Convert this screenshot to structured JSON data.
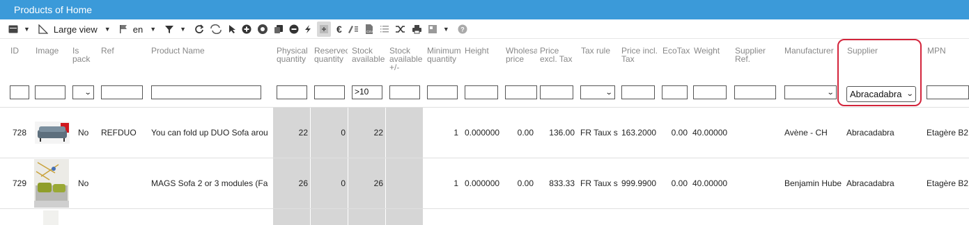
{
  "title": "Products of Home",
  "toolbar": {
    "view_label": "Large view",
    "lang_label": "en"
  },
  "columns": [
    {
      "key": "id",
      "label": "ID"
    },
    {
      "key": "image",
      "label": "Image"
    },
    {
      "key": "is_pack",
      "label": "Is pack"
    },
    {
      "key": "ref",
      "label": "Ref"
    },
    {
      "key": "name",
      "label": "Product Name"
    },
    {
      "key": "physical_qty",
      "label": "Physical quantity"
    },
    {
      "key": "reserved_qty",
      "label": "Reservec quantity"
    },
    {
      "key": "stock_available",
      "label": "Stock available"
    },
    {
      "key": "stock_available_pm",
      "label": "Stock available +/-"
    },
    {
      "key": "min_qty",
      "label": "Minimum quantity"
    },
    {
      "key": "height",
      "label": "Height"
    },
    {
      "key": "wholesale_price",
      "label": "Wholesa price"
    },
    {
      "key": "price_excl",
      "label": "Price excl. Tax"
    },
    {
      "key": "tax_rule",
      "label": "Tax rule"
    },
    {
      "key": "price_incl",
      "label": "Price incl. Tax"
    },
    {
      "key": "ecotax",
      "label": "EcoTax"
    },
    {
      "key": "weight",
      "label": "Weight"
    },
    {
      "key": "supplier_ref",
      "label": "Supplier Ref."
    },
    {
      "key": "manufacturer",
      "label": "Manufacturer"
    },
    {
      "key": "supplier",
      "label": "Supplier"
    },
    {
      "key": "mpn",
      "label": "MPN"
    }
  ],
  "filters": {
    "stock_available": ">10",
    "supplier": "Abracadabra"
  },
  "rows": [
    {
      "id": "728",
      "is_pack": "No",
      "ref": "REFDUO",
      "name": "You can fold up DUO Sofa arou",
      "physical_qty": "22",
      "reserved_qty": "0",
      "stock_available": "22",
      "min_qty": "1",
      "height": "0.000000",
      "wholesale_price": "0.00",
      "price_excl": "136.00",
      "tax_rule": "FR Taux s",
      "price_incl": "163.2000",
      "ecotax": "0.00",
      "weight": "40.00000",
      "manufacturer": "Avène - CH",
      "supplier": "Abracadabra",
      "mpn": "Etagère B2"
    },
    {
      "id": "729",
      "is_pack": "No",
      "ref": "",
      "name": "MAGS Sofa 2 or 3 modules (Fa",
      "physical_qty": "26",
      "reserved_qty": "0",
      "stock_available": "26",
      "min_qty": "1",
      "height": "0.000000",
      "wholesale_price": "0.00",
      "price_excl": "833.33",
      "tax_rule": "FR Taux s",
      "price_incl": "999.9900",
      "ecotax": "0.00",
      "weight": "40.00000",
      "manufacturer": "Benjamin Hube",
      "supplier": "Abracadabra",
      "mpn": "Etagère B2"
    }
  ],
  "colors": {
    "titlebar": "#3b9ad9",
    "highlight": "#d3243b",
    "gray_column": "#d6d6d6"
  }
}
